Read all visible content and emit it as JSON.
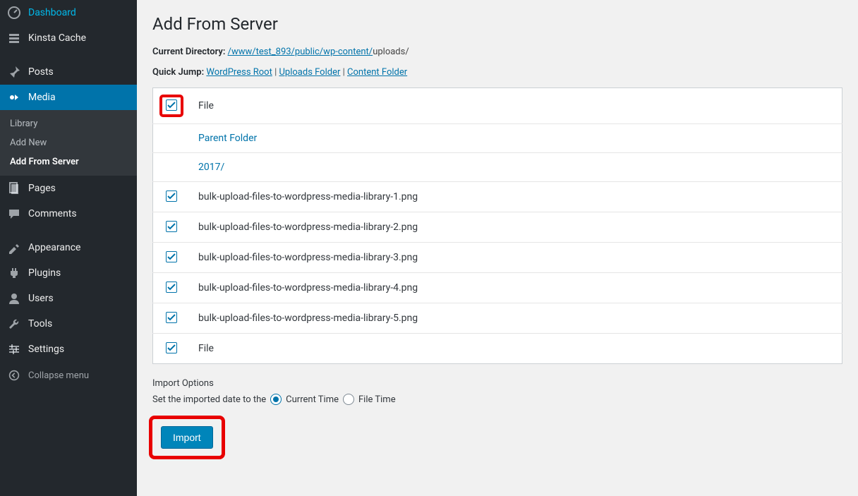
{
  "sidebar": {
    "items": [
      {
        "icon": "dashboard",
        "label": "Dashboard"
      },
      {
        "icon": "cache",
        "label": "Kinsta Cache"
      },
      {
        "icon": "pin",
        "label": "Posts"
      },
      {
        "icon": "media",
        "label": "Media",
        "current": true,
        "submenu": [
          {
            "label": "Library"
          },
          {
            "label": "Add New"
          },
          {
            "label": "Add From Server",
            "current": true
          }
        ]
      },
      {
        "icon": "pages",
        "label": "Pages"
      },
      {
        "icon": "comments",
        "label": "Comments"
      },
      {
        "icon": "appearance",
        "label": "Appearance"
      },
      {
        "icon": "plugins",
        "label": "Plugins"
      },
      {
        "icon": "users",
        "label": "Users"
      },
      {
        "icon": "tools",
        "label": "Tools"
      },
      {
        "icon": "settings",
        "label": "Settings"
      }
    ],
    "collapse": "Collapse menu"
  },
  "page": {
    "title": "Add From Server",
    "currentDir": {
      "label": "Current Directory:",
      "link": "/www/test_893/public/wp-content/",
      "tail": "uploads/"
    },
    "quickJump": {
      "label": "Quick Jump:",
      "links": [
        "WordPress Root",
        "Uploads Folder",
        "Content Folder"
      ]
    },
    "headerFile": "File",
    "rows": [
      {
        "type": "link",
        "label": "Parent Folder",
        "checkbox": false
      },
      {
        "type": "link",
        "label": "2017/",
        "checkbox": false
      },
      {
        "type": "file",
        "label": "bulk-upload-files-to-wordpress-media-library-1.png",
        "checked": true
      },
      {
        "type": "file",
        "label": "bulk-upload-files-to-wordpress-media-library-2.png",
        "checked": true
      },
      {
        "type": "file",
        "label": "bulk-upload-files-to-wordpress-media-library-3.png",
        "checked": true
      },
      {
        "type": "file",
        "label": "bulk-upload-files-to-wordpress-media-library-4.png",
        "checked": true
      },
      {
        "type": "file",
        "label": "bulk-upload-files-to-wordpress-media-library-5.png",
        "checked": true
      }
    ],
    "footerFile": "File",
    "options": {
      "title": "Import Options",
      "dateLabel": "Set the imported date to the",
      "radioCurrent": "Current Time",
      "radioFile": "File Time"
    },
    "importBtn": "Import"
  }
}
